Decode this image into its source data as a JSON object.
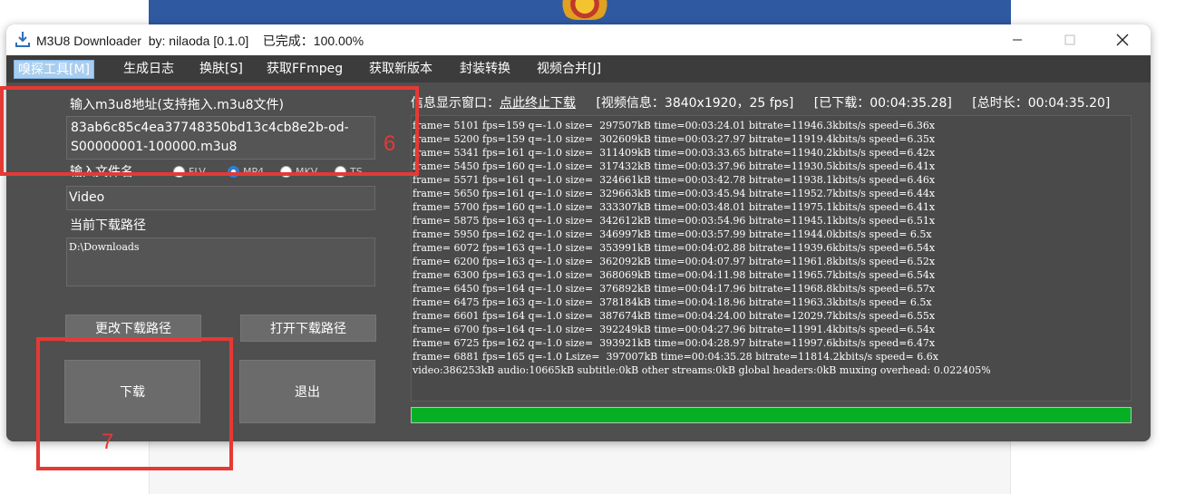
{
  "window": {
    "title": "M3U8 Downloader  by: nilaoda [0.1.0]    已完成：100.00%"
  },
  "menu": {
    "items": [
      "嗅探工具[M]",
      "生成日志",
      "换肤[S]",
      "获取FFmpeg",
      "获取新版本",
      "封装转换",
      "视频合并[J]"
    ]
  },
  "form": {
    "url_label": "输入m3u8地址(支持拖入.m3u8文件)",
    "url_value_line1": "83ab6c85c4ea37748350bd13c4cb8e2b-od-",
    "url_value_line2": "S00000001-100000.m3u8",
    "filename_label": "输入文件名",
    "formats": [
      "FLV",
      "MP4",
      "MKV",
      "TS"
    ],
    "selected_format": "MP4",
    "filename_value": "Video",
    "path_label": "当前下载路径",
    "path_value": "D:\\Downloads"
  },
  "buttons": {
    "change_path": "更改下载路径",
    "open_path": "打开下载路径",
    "download": "下载",
    "exit": "退出"
  },
  "info": {
    "title": "信息显示窗口：",
    "stop_link": "点此终止下载",
    "video_info": "[视频信息：3840x1920，25 fps]",
    "downloaded": "[已下载：00:04:35.28]",
    "total": "[总时长：00:04:35.20]"
  },
  "log": [
    "frame= 5101 fps=159 q=-1.0 size=  297507kB time=00:03:24.01 bitrate=11946.3kbits/s speed=6.36x",
    "frame= 5200 fps=159 q=-1.0 size=  302609kB time=00:03:27.97 bitrate=11919.4kbits/s speed=6.35x",
    "frame= 5341 fps=161 q=-1.0 size=  311409kB time=00:03:33.65 bitrate=11940.2kbits/s speed=6.42x",
    "frame= 5450 fps=160 q=-1.0 size=  317432kB time=00:03:37.96 bitrate=11930.5kbits/s speed=6.41x",
    "frame= 5571 fps=161 q=-1.0 size=  324661kB time=00:03:42.78 bitrate=11938.1kbits/s speed=6.46x",
    "frame= 5650 fps=161 q=-1.0 size=  329663kB time=00:03:45.94 bitrate=11952.7kbits/s speed=6.44x",
    "frame= 5700 fps=160 q=-1.0 size=  333307kB time=00:03:48.01 bitrate=11975.1kbits/s speed=6.41x",
    "frame= 5875 fps=163 q=-1.0 size=  342612kB time=00:03:54.96 bitrate=11945.1kbits/s speed=6.51x",
    "frame= 5950 fps=162 q=-1.0 size=  346997kB time=00:03:57.99 bitrate=11944.0kbits/s speed= 6.5x",
    "frame= 6072 fps=163 q=-1.0 size=  353991kB time=00:04:02.88 bitrate=11939.6kbits/s speed=6.54x",
    "frame= 6200 fps=163 q=-1.0 size=  362092kB time=00:04:07.97 bitrate=11961.8kbits/s speed=6.52x",
    "frame= 6300 fps=163 q=-1.0 size=  368069kB time=00:04:11.98 bitrate=11965.7kbits/s speed=6.54x",
    "frame= 6450 fps=164 q=-1.0 size=  376892kB time=00:04:17.96 bitrate=11968.8kbits/s speed=6.57x",
    "frame= 6475 fps=163 q=-1.0 size=  378184kB time=00:04:18.96 bitrate=11963.3kbits/s speed= 6.5x",
    "frame= 6601 fps=164 q=-1.0 size=  387674kB time=00:04:24.00 bitrate=12029.7kbits/s speed=6.55x",
    "frame= 6700 fps=164 q=-1.0 size=  392249kB time=00:04:27.96 bitrate=11991.4kbits/s speed=6.54x",
    "frame= 6725 fps=162 q=-1.0 size=  393921kB time=00:04:28.97 bitrate=11997.6kbits/s speed=6.47x",
    "frame= 6881 fps=165 q=-1.0 Lsize=  397007kB time=00:04:35.28 bitrate=11814.2kbits/s speed= 6.6x",
    "video:386253kB audio:10665kB subtitle:0kB other streams:0kB global headers:0kB muxing overhead: 0.022405%"
  ],
  "progress_fraction": 1.0,
  "colors": {
    "progress": "#06b025",
    "annotation": "#e53935",
    "window_bg": "#4f4f4f"
  },
  "annotations": {
    "label_6": "6",
    "label_7": "7"
  }
}
